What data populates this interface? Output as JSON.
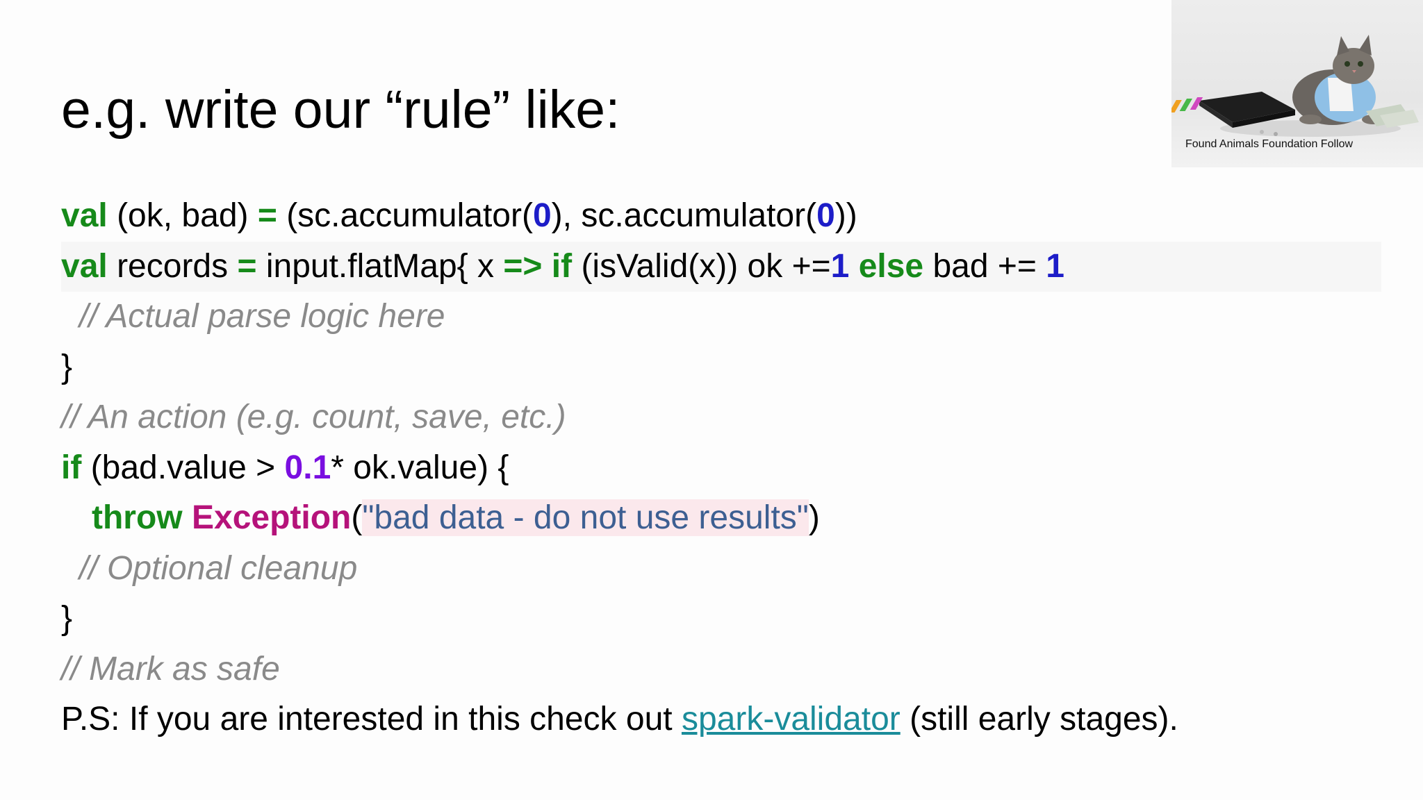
{
  "slide": {
    "title": "e.g. write our “rule” like:",
    "code": {
      "l1": {
        "kw1": "val",
        "t1": " (ok, bad) ",
        "op": "=",
        "t2": " (sc.accumulator(",
        "n1": "0",
        "t3": "), sc.accumulator(",
        "n2": "0",
        "t4": "))"
      },
      "l2": {
        "kw1": "val",
        "t1": " records ",
        "op": "=",
        "t2": " input.flatMap{ x ",
        "arrow": "=>",
        "sp1": " ",
        "kw2": "if",
        "t3": " (isValid(x)) ok +=",
        "n1": "1",
        "sp2": " ",
        "kw3": "else",
        "t4": " bad += ",
        "n2": "1"
      },
      "l3": {
        "comment": "// Actual parse logic here"
      },
      "l4": {
        "brace": "}"
      },
      "l5": {
        "comment": "// An action (e.g. count, save, etc.)"
      },
      "l6": {
        "kw": "if",
        "t1": " (bad.value > ",
        "n": "0.1",
        "t2": "* ok.value) {"
      },
      "l7": {
        "kw": "throw",
        "sp": " ",
        "cls": "Exception",
        "p1": "(",
        "str": "\"bad data - do not use results\"",
        "p2": ")"
      },
      "l8": {
        "comment": "// Optional cleanup"
      },
      "l9": {
        "brace": "}"
      },
      "l10": {
        "comment": "// Mark as safe"
      }
    },
    "ps": {
      "prefix": "P.S: If you are interested in this check out ",
      "link": "spark-validator",
      "suffix": " (still early stages)."
    }
  },
  "thumbnail": {
    "caption": "Found Animals Foundation Follow",
    "icon": "cat-photo"
  },
  "colors": {
    "keyword": "#168a1a",
    "number": "#1d1dc8",
    "decimal": "#7a0ee0",
    "class": "#b5127a",
    "string": "#3d5f92",
    "comment": "#8a8a8a",
    "link": "#1a8c9a"
  }
}
